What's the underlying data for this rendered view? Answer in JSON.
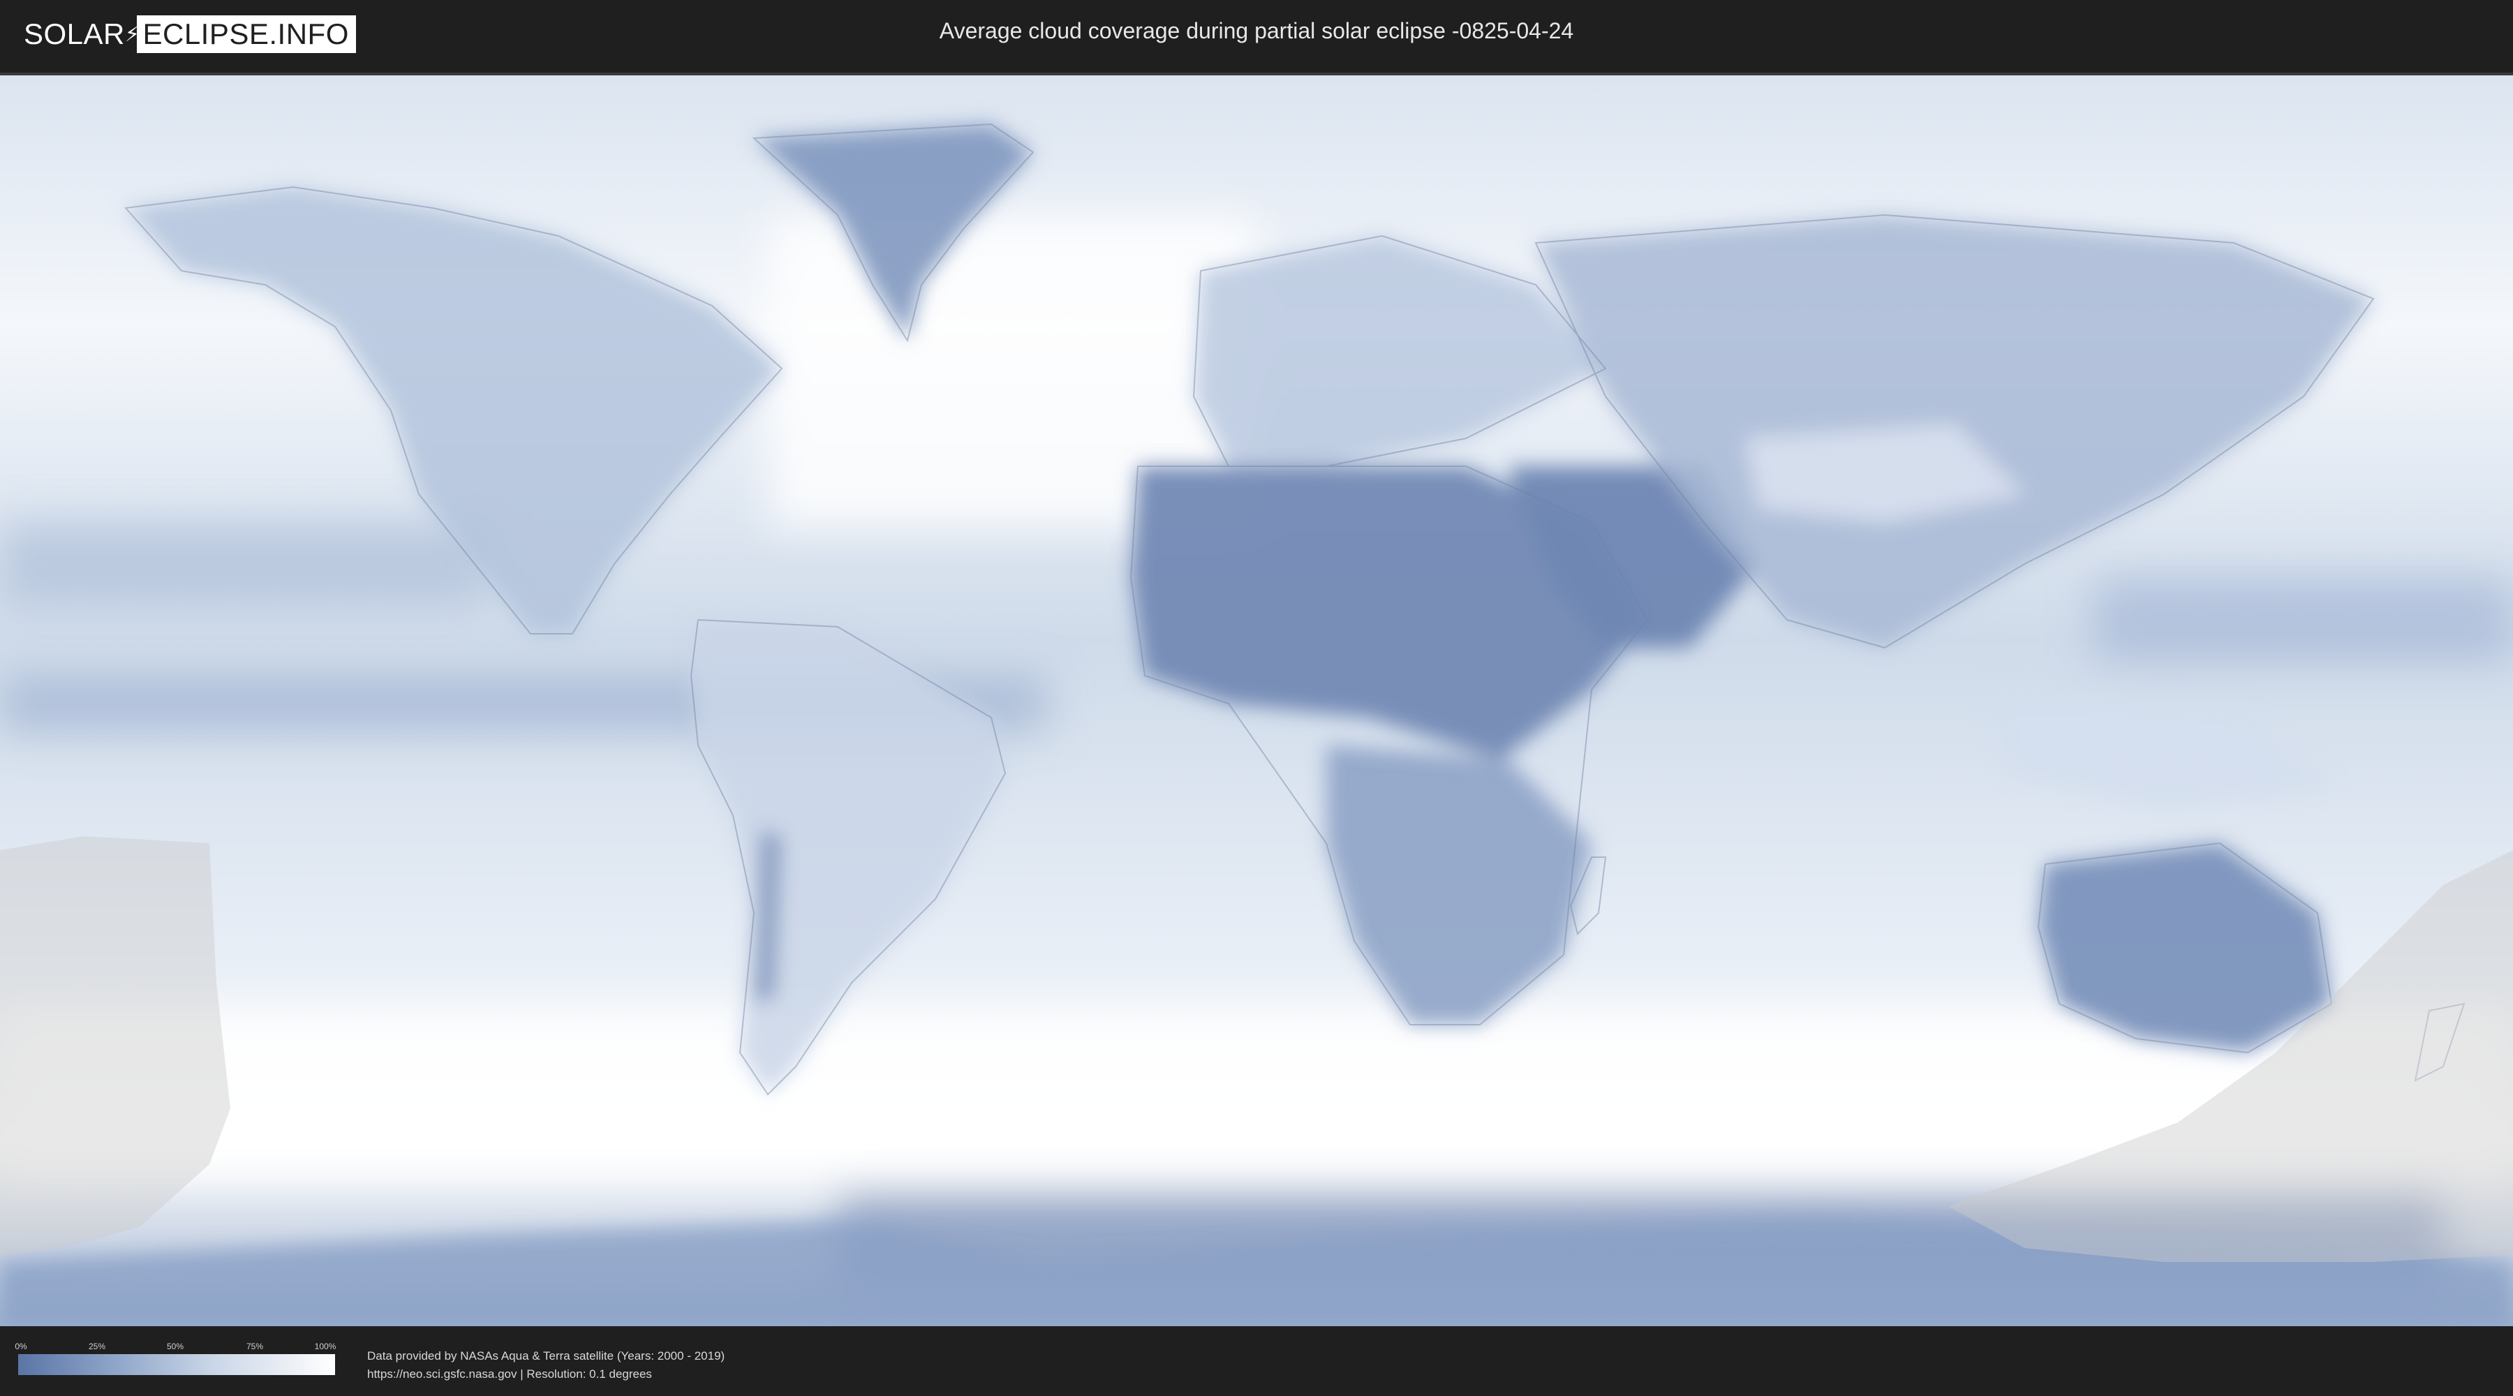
{
  "header": {
    "logo_left": "SOLAR",
    "logo_right": "ECLIPSE.INFO",
    "title": "Average cloud coverage during partial solar eclipse -0825-04-24"
  },
  "map": {
    "clear_color": "#5a75a6",
    "cloud_color": "#ffffff",
    "land_outline_color": "#6f83a3",
    "eclipse_zone_color": "#cccccc"
  },
  "legend": {
    "ticks": [
      "0%",
      "25%",
      "50%",
      "75%",
      "100%"
    ]
  },
  "footer": {
    "credit_line1": "Data provided by NASAs Aqua & Terra satellite (Years: 2000 - 2019)",
    "credit_line2": "https://neo.sci.gsfc.nasa.gov | Resolution: 0.1 degrees"
  }
}
